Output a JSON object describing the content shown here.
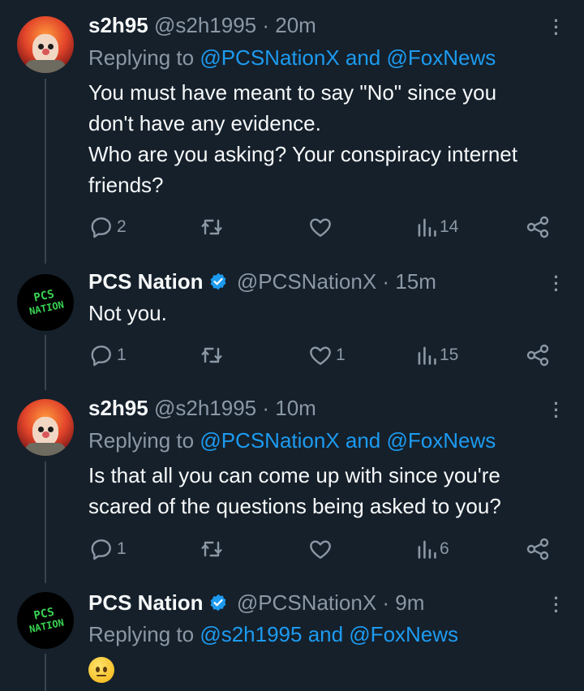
{
  "tweets": [
    {
      "display_name": "s2h95",
      "handle": "@s2h1995",
      "time": "· 20m",
      "replying_prefix": "Replying to",
      "replying_to": "@PCSNationX and @FoxNews",
      "lines": [
        "You must have meant to say \"No\" since you",
        "don't have any evidence.",
        "Who are you asking? Your conspiracy internet",
        "friends?"
      ],
      "replies": "2",
      "retweets": "",
      "likes": "",
      "views": "14",
      "verified": false
    },
    {
      "display_name": "PCS Nation",
      "handle": "@PCSNationX",
      "time": "· 15m",
      "lines": [
        "Not you."
      ],
      "replies": "1",
      "retweets": "",
      "likes": "1",
      "views": "15",
      "verified": true
    },
    {
      "display_name": "s2h95",
      "handle": "@s2h1995",
      "time": "· 10m",
      "replying_prefix": "Replying to",
      "replying_to": "@PCSNationX and @FoxNews",
      "lines": [
        "Is that all you can come up with since you're",
        "scared of the questions being asked to you?"
      ],
      "replies": "1",
      "retweets": "",
      "likes": "",
      "views": "6",
      "verified": false
    },
    {
      "display_name": "PCS Nation",
      "handle": "@PCSNationX",
      "time": "· 9m",
      "replying_prefix": "Replying to",
      "replying_to": "@s2h1995 and @FoxNews",
      "emoji": "neutral-face",
      "verified": true
    }
  ],
  "avatar_pcs_text": [
    "PCS",
    "NATION"
  ],
  "colors": {
    "background": "#15202b",
    "text": "#f7f9f9",
    "muted": "#8b98a5",
    "link": "#1d9bf0",
    "verified": "#1d9bf0",
    "thread_line": "#38444d",
    "pcs_green": "#39d353"
  },
  "icons": [
    "reply-icon",
    "retweet-icon",
    "like-icon",
    "views-icon",
    "share-icon",
    "more-icon",
    "verified-badge-icon"
  ]
}
